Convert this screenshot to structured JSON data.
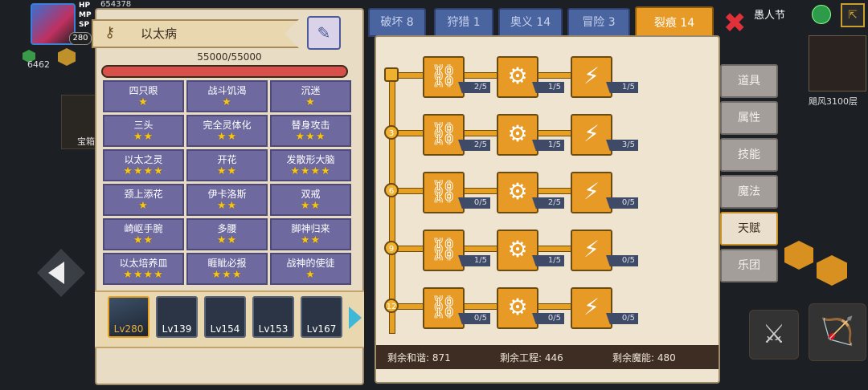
{
  "hud": {
    "gold": "654378",
    "hp_label": "HP",
    "mp_label": "MP",
    "sp_label": "SP",
    "level_badge": "280",
    "gem_count": "6462",
    "left_label": "宝箱",
    "date_label": "愚人节",
    "floor_label": "飓风3100层"
  },
  "disease": {
    "title": "以太病",
    "hp": "55000/55000",
    "hp_fraction": 1.0,
    "traits": [
      {
        "name": "四只眼",
        "stars": "★"
      },
      {
        "name": "战斗饥渴",
        "stars": "★"
      },
      {
        "name": "沉迷",
        "stars": "★"
      },
      {
        "name": "三头",
        "stars": "★★"
      },
      {
        "name": "完全灵体化",
        "stars": "★★"
      },
      {
        "name": "替身攻击",
        "stars": "★★★"
      },
      {
        "name": "以太之灵",
        "stars": "★★★★"
      },
      {
        "name": "开花",
        "stars": "★★"
      },
      {
        "name": "发散形大脑",
        "stars": "★★★★"
      },
      {
        "name": "颈上添花",
        "stars": "★"
      },
      {
        "name": "伊卡洛斯",
        "stars": "★★"
      },
      {
        "name": "双戒",
        "stars": "★★"
      },
      {
        "name": "崎岖手腕",
        "stars": "★★"
      },
      {
        "name": "多腰",
        "stars": "★★"
      },
      {
        "name": "脚神归来",
        "stars": "★★"
      },
      {
        "name": "以太培养皿",
        "stars": "★★★★"
      },
      {
        "name": "睚眦必报",
        "stars": "★★★"
      },
      {
        "name": "战神的使徒",
        "stars": "★"
      }
    ]
  },
  "pets": [
    {
      "level": "Lv280",
      "selected": true
    },
    {
      "level": "Lv139",
      "selected": false
    },
    {
      "level": "Lv154",
      "selected": false
    },
    {
      "level": "Lv153",
      "selected": false
    },
    {
      "level": "Lv167",
      "selected": false
    }
  ],
  "tabs": [
    {
      "label": "破坏 8"
    },
    {
      "label": "狩猎 1"
    },
    {
      "label": "奥义 14"
    },
    {
      "label": "冒险 3"
    },
    {
      "label": "裂痕 14"
    }
  ],
  "active_tab": "裂痕 14",
  "talent_tree": {
    "rows": [
      {
        "level": "",
        "counts": [
          "2/5",
          "1/5",
          "1/5"
        ]
      },
      {
        "level": "3",
        "counts": [
          "2/5",
          "1/5",
          "3/5"
        ]
      },
      {
        "level": "6",
        "counts": [
          "0/5",
          "2/5",
          "0/5"
        ]
      },
      {
        "level": "9",
        "counts": [
          "1/5",
          "1/5",
          "0/5"
        ]
      },
      {
        "level": "12",
        "counts": [
          "0/5",
          "0/5",
          "0/5"
        ]
      }
    ],
    "icons": [
      "chain-link-icon",
      "gears-icon",
      "claw-slash-icon"
    ]
  },
  "remaining": {
    "harmony": "剩余和谐: 871",
    "engineering": "剩余工程: 446",
    "magic": "剩余魔能: 480"
  },
  "side_menu": [
    {
      "label": "道具"
    },
    {
      "label": "属性"
    },
    {
      "label": "技能"
    },
    {
      "label": "魔法"
    },
    {
      "label": "天赋"
    },
    {
      "label": "乐团"
    }
  ],
  "colors": {
    "accent": "#e89a26",
    "tab_blue": "#4a64a0",
    "trait_purple": "#6e6aa0",
    "hp_red": "#d8504a"
  }
}
